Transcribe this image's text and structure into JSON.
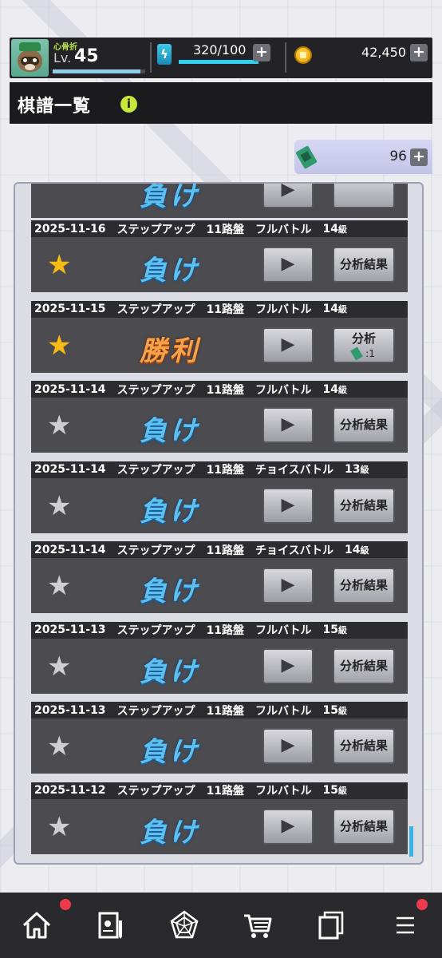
{
  "player": {
    "name": "心骨折",
    "level_label": "Lv.",
    "level": "45",
    "xp_progress": 0.95
  },
  "resources": {
    "energy": "320/100",
    "energy_progress": 1.0,
    "coins": "42,450",
    "tickets": "96"
  },
  "page": {
    "title": "棋譜一覧",
    "info_icon": "info-icon"
  },
  "records": [
    {
      "date": "2025-11-16",
      "mode": "ステップアップ",
      "board": "11路盤",
      "type": "フルバトル",
      "grade": "14",
      "grade_unit": "級",
      "starred": true,
      "result": "負け",
      "result_kind": "lose",
      "analysis": "分析結果"
    },
    {
      "date": "2025-11-15",
      "mode": "ステップアップ",
      "board": "11路盤",
      "type": "フルバトル",
      "grade": "14",
      "grade_unit": "級",
      "starred": true,
      "result": "勝利",
      "result_kind": "win",
      "analysis": "分析",
      "analysis_cost": ":1"
    },
    {
      "date": "2025-11-14",
      "mode": "ステップアップ",
      "board": "11路盤",
      "type": "フルバトル",
      "grade": "14",
      "grade_unit": "級",
      "starred": false,
      "result": "負け",
      "result_kind": "lose",
      "analysis": "分析結果"
    },
    {
      "date": "2025-11-14",
      "mode": "ステップアップ",
      "board": "11路盤",
      "type": "チョイスバトル",
      "grade": "13",
      "grade_unit": "級",
      "starred": false,
      "result": "負け",
      "result_kind": "lose",
      "analysis": "分析結果"
    },
    {
      "date": "2025-11-14",
      "mode": "ステップアップ",
      "board": "11路盤",
      "type": "チョイスバトル",
      "grade": "14",
      "grade_unit": "級",
      "starred": false,
      "result": "負け",
      "result_kind": "lose",
      "analysis": "分析結果"
    },
    {
      "date": "2025-11-13",
      "mode": "ステップアップ",
      "board": "11路盤",
      "type": "フルバトル",
      "grade": "15",
      "grade_unit": "級",
      "starred": false,
      "result": "負け",
      "result_kind": "lose",
      "analysis": "分析結果"
    },
    {
      "date": "2025-11-13",
      "mode": "ステップアップ",
      "board": "11路盤",
      "type": "フルバトル",
      "grade": "15",
      "grade_unit": "級",
      "starred": false,
      "result": "負け",
      "result_kind": "lose",
      "analysis": "分析結果"
    },
    {
      "date": "2025-11-12",
      "mode": "ステップアップ",
      "board": "11路盤",
      "type": "フルバトル",
      "grade": "15",
      "grade_unit": "級",
      "starred": false,
      "result": "負け",
      "result_kind": "lose",
      "analysis": "分析結果"
    }
  ],
  "partial_record": {
    "result": "負け"
  },
  "nav": [
    {
      "icon": "home-icon",
      "badge": true
    },
    {
      "icon": "kifu-record-icon",
      "badge": false
    },
    {
      "icon": "radar-chart-icon",
      "badge": false
    },
    {
      "icon": "shop-cart-icon",
      "badge": false
    },
    {
      "icon": "collection-cards-icon",
      "badge": false
    },
    {
      "icon": "menu-icon",
      "badge": true
    }
  ],
  "colors": {
    "accent_cyan": "#2fd2f0",
    "star_on": "#f6bb16",
    "lose_text": "#5ec0ef",
    "win_text": "#f6a24a",
    "badge_red": "#ee3a4a"
  }
}
